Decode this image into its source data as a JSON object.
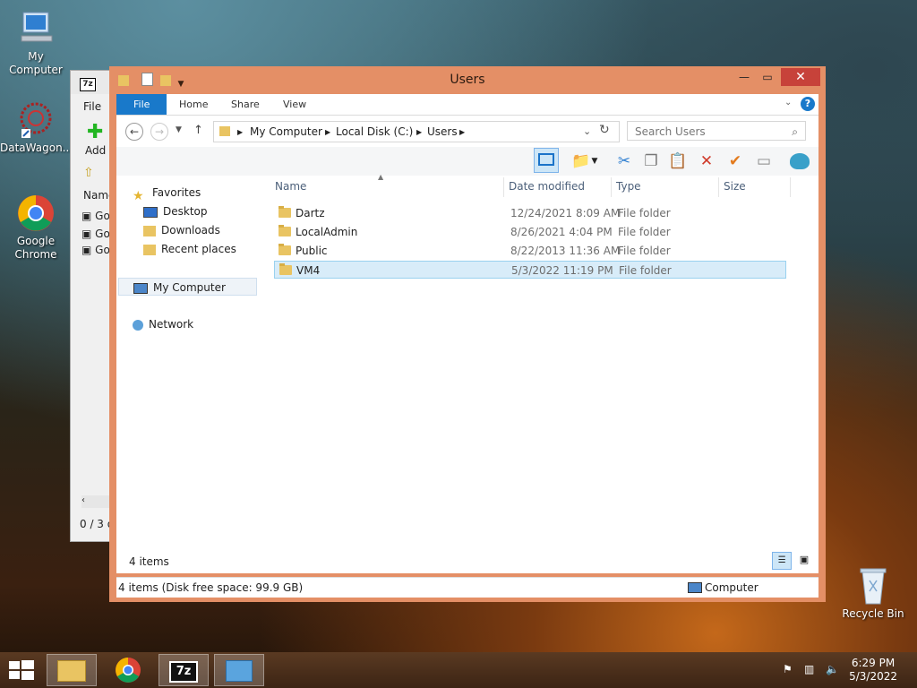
{
  "desktop": {
    "icons": [
      {
        "label": "My Computer"
      },
      {
        "label": "DataWagon..."
      },
      {
        "label": "Google Chrome"
      },
      {
        "label": "Recycle Bin"
      }
    ]
  },
  "zip_window": {
    "logo": "7z",
    "menu_file": "File",
    "add_label": "Add",
    "col_name": "Name",
    "rows": [
      "Go",
      "Go",
      "Go"
    ],
    "status": "0 / 3 o"
  },
  "explorer": {
    "title": "Users",
    "ribbon_tabs": [
      "File",
      "Home",
      "Share",
      "View"
    ],
    "breadcrumb": [
      "My Computer",
      "Local Disk (C:)",
      "Users"
    ],
    "search_placeholder": "Search Users",
    "nav": {
      "favorites": "Favorites",
      "desktop": "Desktop",
      "downloads": "Downloads",
      "recent": "Recent places",
      "computer": "My Computer",
      "network": "Network"
    },
    "columns": [
      "Name",
      "Date modified",
      "Type",
      "Size"
    ],
    "rows": [
      {
        "name": "Dartz",
        "date": "12/24/2021 8:09 AM",
        "type": "File folder"
      },
      {
        "name": "LocalAdmin",
        "date": "8/26/2021 4:04 PM",
        "type": "File folder"
      },
      {
        "name": "Public",
        "date": "8/22/2013 11:36 AM",
        "type": "File folder"
      },
      {
        "name": "VM4",
        "date": "5/3/2022 11:19 PM",
        "type": "File folder"
      }
    ],
    "item_count": "4 items",
    "status_left": "4 items (Disk free space: 99.9 GB)",
    "status_right": "Computer"
  },
  "taskbar": {
    "time": "6:29 PM",
    "date": "5/3/2022",
    "seven_zip": "7z"
  },
  "colors": {
    "window_frame": "#e48f66",
    "file_tab": "#1979ca",
    "close_button": "#c7423a",
    "selection": "#d8ecf9"
  }
}
